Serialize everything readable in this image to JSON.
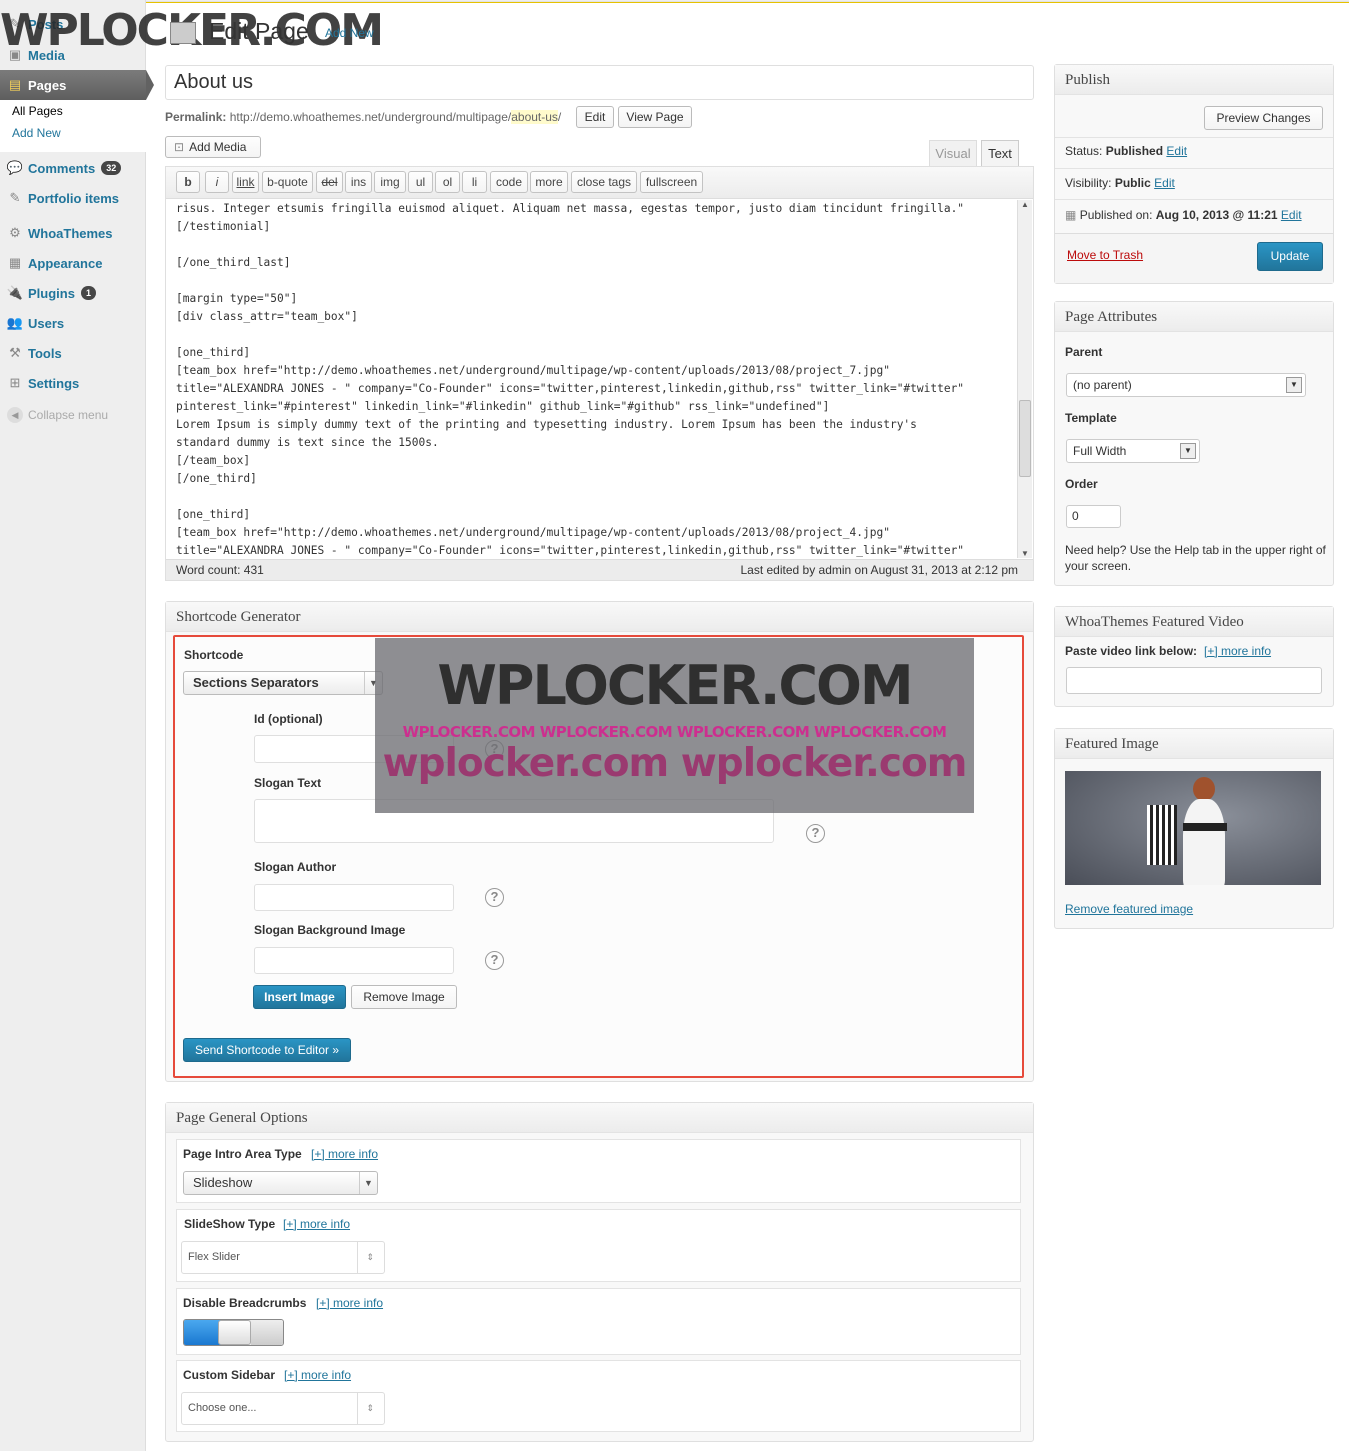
{
  "colors": {
    "accent": "#21759b",
    "primary_button": "#2a95c5",
    "danger": "#bc0b0b",
    "highlight_box": "#e64a3b",
    "watermark": "#333333",
    "watermark_pink": "#cc2f8f"
  },
  "sidebar": {
    "items": [
      {
        "label": "Posts",
        "icon": "pin-icon"
      },
      {
        "label": "Media",
        "icon": "media-icon"
      },
      {
        "label": "Pages",
        "icon": "pages-icon"
      },
      {
        "label": "Comments",
        "icon": "comment-icon",
        "badge": "32"
      },
      {
        "label": "Portfolio items",
        "icon": "pin-icon"
      },
      {
        "label": "WhoaThemes",
        "icon": "gear-icon"
      },
      {
        "label": "Appearance",
        "icon": "appearance-icon"
      },
      {
        "label": "Plugins",
        "icon": "plugin-icon",
        "badge": "1"
      },
      {
        "label": "Users",
        "icon": "users-icon"
      },
      {
        "label": "Tools",
        "icon": "tools-icon"
      },
      {
        "label": "Settings",
        "icon": "settings-icon"
      }
    ],
    "submenu": [
      "All Pages",
      "Add New"
    ],
    "collapse": "Collapse menu"
  },
  "header": {
    "title": "Edit Page",
    "add_new": "Add New",
    "watermark": "WPLOCKER.COM"
  },
  "editor": {
    "title": "About us",
    "permalink_label": "Permalink:",
    "permalink_base": "http://demo.whoathemes.net/underground/multipage/",
    "permalink_slug": "about-us",
    "permalink_end": "/",
    "edit_btn": "Edit",
    "view_btn": "View Page",
    "add_media": "Add Media",
    "tab_visual": "Visual",
    "tab_text": "Text",
    "quicktags": [
      "b",
      "i",
      "link",
      "b-quote",
      "del",
      "ins",
      "img",
      "ul",
      "ol",
      "li",
      "code",
      "more",
      "close tags",
      "fullscreen"
    ],
    "content": "risus. Integer etsumis fringilla euismod aliquet. Aliquam net massa, egestas tempor, justo diam tincidunt fringilla.\"\n[/testimonial]\n\n[/one_third_last]\n\n[margin type=\"50\"]\n[div class_attr=\"team_box\"]\n\n[one_third]\n[team_box href=\"http://demo.whoathemes.net/underground/multipage/wp-content/uploads/2013/08/project_7.jpg\"\ntitle=\"ALEXANDRA JONES - \" company=\"Co-Founder\" icons=\"twitter,pinterest,linkedin,github,rss\" twitter_link=\"#twitter\"\npinterest_link=\"#pinterest\" linkedin_link=\"#linkedin\" github_link=\"#github\" rss_link=\"undefined\"]\nLorem Ipsum is simply dummy text of the printing and typesetting industry. Lorem Ipsum has been the industry's\nstandard dummy is text since the 1500s.\n[/team_box]\n[/one_third]\n\n[one_third]\n[team_box href=\"http://demo.whoathemes.net/underground/multipage/wp-content/uploads/2013/08/project_4.jpg\"\ntitle=\"ALEXANDRA JONES - \" company=\"Co-Founder\" icons=\"twitter,pinterest,linkedin,github,rss\" twitter_link=\"#twitter\"",
    "word_count": "Word count: 431",
    "last_edited": "Last edited by admin on August 31, 2013 at 2:12 pm"
  },
  "shortcode": {
    "title": "Shortcode Generator",
    "label": "Shortcode",
    "selected": "Sections Separators",
    "id_label": "Id (optional)",
    "slogan_text_label": "Slogan Text",
    "slogan_author_label": "Slogan Author",
    "slogan_bg_label": "Slogan Background Image",
    "insert_image": "Insert Image",
    "remove_image": "Remove Image",
    "send": "Send Shortcode to Editor »",
    "watermark_big": "WPLOCKER.COM",
    "watermark_mid": "WPLOCKER.COM WPLOCKER.COM WPLOCKER.COM WPLOCKER.COM",
    "watermark_low": "wplocker.com wplocker.com"
  },
  "general": {
    "title": "Page General Options",
    "intro_label": "Page Intro Area Type",
    "more_info": "[+] more info",
    "intro_value": "Slideshow",
    "slideshow_label": "SlideShow Type",
    "slideshow_value": "Flex Slider",
    "breadcrumbs_label": "Disable Breadcrumbs",
    "sidebar_label": "Custom Sidebar",
    "sidebar_value": "Choose one..."
  },
  "publish": {
    "title": "Publish",
    "preview": "Preview Changes",
    "status_label": "Status:",
    "status_value": "Published",
    "visibility_label": "Visibility:",
    "visibility_value": "Public",
    "published_label": "Published on:",
    "published_value": "Aug 10, 2013 @ 11:21",
    "edit": "Edit",
    "trash": "Move to Trash",
    "update": "Update"
  },
  "attributes": {
    "title": "Page Attributes",
    "parent_label": "Parent",
    "parent_value": "(no parent)",
    "template_label": "Template",
    "template_value": "Full Width",
    "order_label": "Order",
    "order_value": "0",
    "help": "Need help? Use the Help tab in the upper right of your screen."
  },
  "video": {
    "title": "WhoaThemes Featured Video",
    "label": "Paste video link below:",
    "more_info": "[+] more info"
  },
  "featured": {
    "title": "Featured Image",
    "remove": "Remove featured image"
  }
}
